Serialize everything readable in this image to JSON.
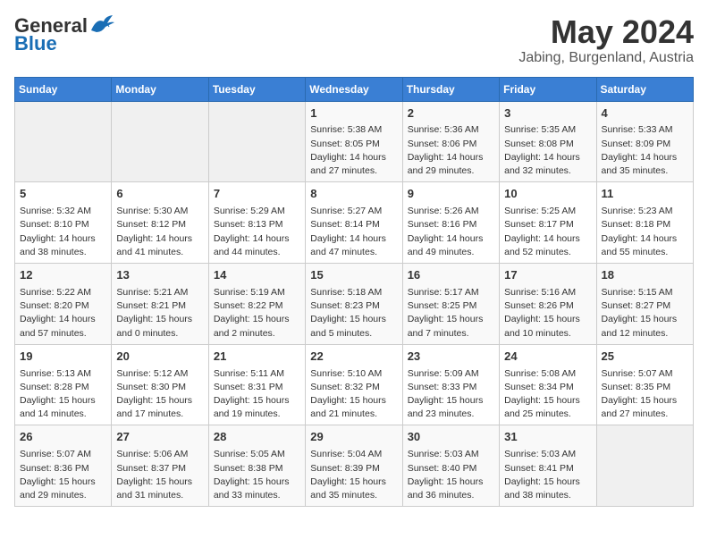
{
  "header": {
    "logo_general": "General",
    "logo_blue": "Blue",
    "month": "May 2024",
    "location": "Jabing, Burgenland, Austria"
  },
  "weekdays": [
    "Sunday",
    "Monday",
    "Tuesday",
    "Wednesday",
    "Thursday",
    "Friday",
    "Saturday"
  ],
  "weeks": [
    [
      {
        "day": "",
        "info": ""
      },
      {
        "day": "",
        "info": ""
      },
      {
        "day": "",
        "info": ""
      },
      {
        "day": "1",
        "info": "Sunrise: 5:38 AM\nSunset: 8:05 PM\nDaylight: 14 hours\nand 27 minutes."
      },
      {
        "day": "2",
        "info": "Sunrise: 5:36 AM\nSunset: 8:06 PM\nDaylight: 14 hours\nand 29 minutes."
      },
      {
        "day": "3",
        "info": "Sunrise: 5:35 AM\nSunset: 8:08 PM\nDaylight: 14 hours\nand 32 minutes."
      },
      {
        "day": "4",
        "info": "Sunrise: 5:33 AM\nSunset: 8:09 PM\nDaylight: 14 hours\nand 35 minutes."
      }
    ],
    [
      {
        "day": "5",
        "info": "Sunrise: 5:32 AM\nSunset: 8:10 PM\nDaylight: 14 hours\nand 38 minutes."
      },
      {
        "day": "6",
        "info": "Sunrise: 5:30 AM\nSunset: 8:12 PM\nDaylight: 14 hours\nand 41 minutes."
      },
      {
        "day": "7",
        "info": "Sunrise: 5:29 AM\nSunset: 8:13 PM\nDaylight: 14 hours\nand 44 minutes."
      },
      {
        "day": "8",
        "info": "Sunrise: 5:27 AM\nSunset: 8:14 PM\nDaylight: 14 hours\nand 47 minutes."
      },
      {
        "day": "9",
        "info": "Sunrise: 5:26 AM\nSunset: 8:16 PM\nDaylight: 14 hours\nand 49 minutes."
      },
      {
        "day": "10",
        "info": "Sunrise: 5:25 AM\nSunset: 8:17 PM\nDaylight: 14 hours\nand 52 minutes."
      },
      {
        "day": "11",
        "info": "Sunrise: 5:23 AM\nSunset: 8:18 PM\nDaylight: 14 hours\nand 55 minutes."
      }
    ],
    [
      {
        "day": "12",
        "info": "Sunrise: 5:22 AM\nSunset: 8:20 PM\nDaylight: 14 hours\nand 57 minutes."
      },
      {
        "day": "13",
        "info": "Sunrise: 5:21 AM\nSunset: 8:21 PM\nDaylight: 15 hours\nand 0 minutes."
      },
      {
        "day": "14",
        "info": "Sunrise: 5:19 AM\nSunset: 8:22 PM\nDaylight: 15 hours\nand 2 minutes."
      },
      {
        "day": "15",
        "info": "Sunrise: 5:18 AM\nSunset: 8:23 PM\nDaylight: 15 hours\nand 5 minutes."
      },
      {
        "day": "16",
        "info": "Sunrise: 5:17 AM\nSunset: 8:25 PM\nDaylight: 15 hours\nand 7 minutes."
      },
      {
        "day": "17",
        "info": "Sunrise: 5:16 AM\nSunset: 8:26 PM\nDaylight: 15 hours\nand 10 minutes."
      },
      {
        "day": "18",
        "info": "Sunrise: 5:15 AM\nSunset: 8:27 PM\nDaylight: 15 hours\nand 12 minutes."
      }
    ],
    [
      {
        "day": "19",
        "info": "Sunrise: 5:13 AM\nSunset: 8:28 PM\nDaylight: 15 hours\nand 14 minutes."
      },
      {
        "day": "20",
        "info": "Sunrise: 5:12 AM\nSunset: 8:30 PM\nDaylight: 15 hours\nand 17 minutes."
      },
      {
        "day": "21",
        "info": "Sunrise: 5:11 AM\nSunset: 8:31 PM\nDaylight: 15 hours\nand 19 minutes."
      },
      {
        "day": "22",
        "info": "Sunrise: 5:10 AM\nSunset: 8:32 PM\nDaylight: 15 hours\nand 21 minutes."
      },
      {
        "day": "23",
        "info": "Sunrise: 5:09 AM\nSunset: 8:33 PM\nDaylight: 15 hours\nand 23 minutes."
      },
      {
        "day": "24",
        "info": "Sunrise: 5:08 AM\nSunset: 8:34 PM\nDaylight: 15 hours\nand 25 minutes."
      },
      {
        "day": "25",
        "info": "Sunrise: 5:07 AM\nSunset: 8:35 PM\nDaylight: 15 hours\nand 27 minutes."
      }
    ],
    [
      {
        "day": "26",
        "info": "Sunrise: 5:07 AM\nSunset: 8:36 PM\nDaylight: 15 hours\nand 29 minutes."
      },
      {
        "day": "27",
        "info": "Sunrise: 5:06 AM\nSunset: 8:37 PM\nDaylight: 15 hours\nand 31 minutes."
      },
      {
        "day": "28",
        "info": "Sunrise: 5:05 AM\nSunset: 8:38 PM\nDaylight: 15 hours\nand 33 minutes."
      },
      {
        "day": "29",
        "info": "Sunrise: 5:04 AM\nSunset: 8:39 PM\nDaylight: 15 hours\nand 35 minutes."
      },
      {
        "day": "30",
        "info": "Sunrise: 5:03 AM\nSunset: 8:40 PM\nDaylight: 15 hours\nand 36 minutes."
      },
      {
        "day": "31",
        "info": "Sunrise: 5:03 AM\nSunset: 8:41 PM\nDaylight: 15 hours\nand 38 minutes."
      },
      {
        "day": "",
        "info": ""
      }
    ]
  ]
}
